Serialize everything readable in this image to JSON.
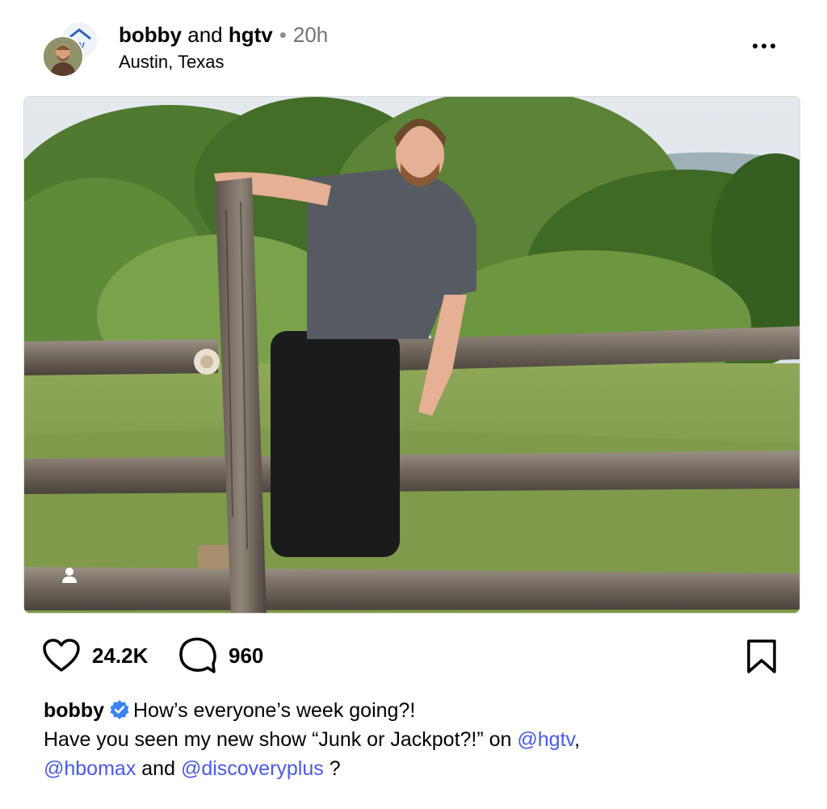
{
  "post": {
    "author": "bobby",
    "and": "and",
    "coauthor": "hgtv",
    "separator": "•",
    "time": "20h",
    "location": "Austin, Texas"
  },
  "actions": {
    "likes": "24.2K",
    "comments": "960"
  },
  "caption": {
    "author": "bobby",
    "line1": "How’s everyone’s week going?!",
    "line2_prefix": "Have you seen my new show “Junk or Jackpot?!” on ",
    "mention1": "@hgtv",
    "comma": ",",
    "mention2": "@hbomax",
    "and": " and ",
    "mention3": "@discoveryplus",
    "suffix": " ?"
  },
  "icons": {
    "like": "heart-icon",
    "comment": "comment-bubble-icon",
    "save": "bookmark-icon",
    "tag": "user-tag-icon",
    "verified": "verified-badge-icon",
    "more": "more-options-icon"
  },
  "colors": {
    "mention": "#4a5ae6",
    "verified": "#3b82f6",
    "muted": "#737373"
  }
}
